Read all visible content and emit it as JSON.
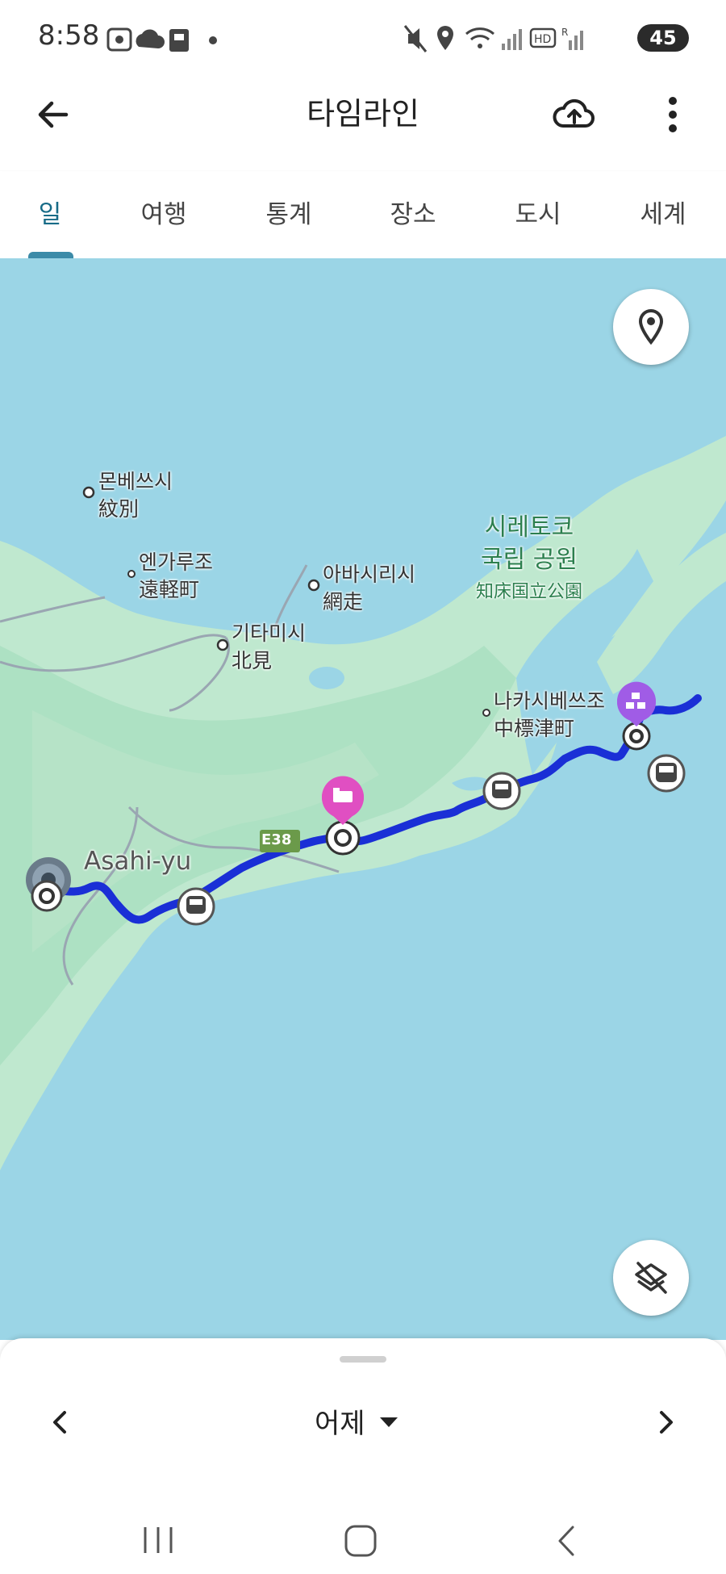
{
  "status_bar": {
    "time": "8:58",
    "battery": "45",
    "battery_level": 0.45,
    "icons": [
      "screenshot-icon",
      "cloud-icon",
      "app-icon",
      "dot-icon",
      "mute-icon",
      "location-icon",
      "wifi-icon",
      "signal-icon",
      "hd-icon",
      "signal-r-icon",
      "battery-icon"
    ]
  },
  "app_bar": {
    "title": "타임라인",
    "back_icon": "back-arrow-icon",
    "upload_icon": "cloud-upload-icon",
    "menu_icon": "more-vert-icon"
  },
  "tabs": [
    {
      "label": "일",
      "active": true
    },
    {
      "label": "여행",
      "active": false
    },
    {
      "label": "통계",
      "active": false
    },
    {
      "label": "장소",
      "active": false
    },
    {
      "label": "도시",
      "active": false
    },
    {
      "label": "세계",
      "active": false
    }
  ],
  "map": {
    "labels": {
      "monbetsu_ko": "몬베쓰시",
      "monbetsu_ja": "紋別",
      "engaru_ko": "엔가루조",
      "engaru_ja": "遠軽町",
      "abashiri_ko": "아바시리시",
      "abashiri_ja": "網走",
      "kitami_ko": "기타미시",
      "kitami_ja": "北見",
      "shiretoko_line1": "시레토코",
      "shiretoko_line2": "국립 공원",
      "shiretoko_ja": "知床国立公園",
      "nakashibetsu_ko": "나카시베쓰조",
      "nakashibetsu_ja": "中標津町",
      "route_badge": "E38",
      "place_name": "Asahi-yu"
    },
    "route_color": "#1a2fd6",
    "water_color": "#9bd5e6",
    "land_color": "#bfe8cf",
    "hotel_pin_color": "#e04fc2",
    "poi_pin_color": "#a05ce6"
  },
  "bottom_sheet": {
    "date_label": "어제",
    "prev_icon": "chevron-left-icon",
    "next_icon": "chevron-right-icon",
    "dropdown_icon": "caret-down-icon"
  },
  "nav_bar": {
    "icons": [
      "recent-apps-icon",
      "home-icon",
      "back-icon"
    ]
  }
}
